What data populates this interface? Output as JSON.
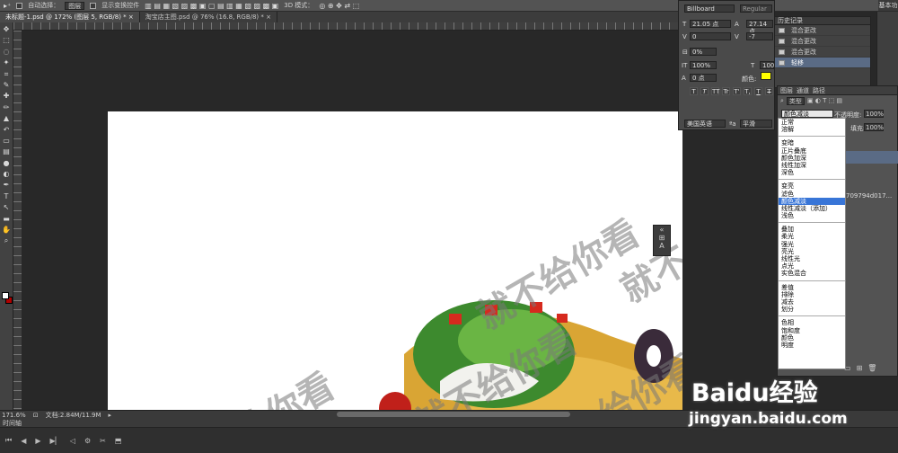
{
  "options_bar": {
    "auto_select_label": "自动选择：",
    "auto_select_value": "图层",
    "show_transform_label": "显示变换控件",
    "mode_3d_label": "3D 模式："
  },
  "tabs": [
    {
      "label": "未标题-1.psd @ 172% (图层 5, RGB/8) *"
    },
    {
      "label": "淘宝店主图.psd @ 76% (16.8, RGB/8) *"
    }
  ],
  "toolbar_icons": [
    "move-icon",
    "marquee-icon",
    "lasso-icon",
    "magic-wand-icon",
    "crop-icon",
    "eyedropper-icon",
    "healing-icon",
    "brush-icon",
    "stamp-icon",
    "history-brush-icon",
    "eraser-icon",
    "gradient-icon",
    "blur-icon",
    "dodge-icon",
    "pen-icon",
    "type-icon",
    "path-select-icon",
    "shape-icon",
    "hand-icon",
    "zoom-icon"
  ],
  "toolbar_glyphs": [
    "✥",
    "⬚",
    "◌",
    "✦",
    "⌗",
    "✎",
    "✚",
    "✏",
    "▲",
    "↶",
    "▭",
    "▤",
    "●",
    "◐",
    "✒",
    "T",
    "↖",
    "▬",
    "✋",
    "⌕"
  ],
  "status": {
    "zoom": "171.6%",
    "doc_size": "文档:2.84M/11.9M"
  },
  "timeline": {
    "title": "时间轴"
  },
  "character": {
    "font_family": "Billboard",
    "font_style": "Regular",
    "font_size": "21.05 点",
    "leading": "27.14 点",
    "kerning": "0",
    "tracking": "-7",
    "vertical_scale_pct": "0%",
    "horizontal_scale": "100%",
    "horizontal_scale2": "100%",
    "baseline": "0 点",
    "color_label": "颜色:",
    "language": "美国英语",
    "aa_label": "ªa",
    "aa_value": "平滑",
    "type_buttons": [
      "T",
      "T",
      "TT",
      "Tr",
      "T'",
      "T,",
      "T",
      "T"
    ]
  },
  "history": {
    "title": "历史记录",
    "items": [
      {
        "label": "混合更改",
        "selected": false
      },
      {
        "label": "混合更改",
        "selected": false
      },
      {
        "label": "混合更改",
        "selected": false
      },
      {
        "label": "轻移",
        "selected": true
      }
    ]
  },
  "workspace": {
    "basic_label": "基本功"
  },
  "layers": {
    "tabs": [
      "图层",
      "通道",
      "路径"
    ],
    "kind_label": "类型",
    "blend_current": "颜色减淡",
    "opacity_label": "不透明度:",
    "opacity_value": "100%",
    "fill_label": "填充:",
    "fill_value": "100%",
    "layer_name_partial": "709794d017..."
  },
  "blend_modes": {
    "groups": [
      [
        {
          "label": "正常"
        },
        {
          "label": "溶解"
        }
      ],
      [
        {
          "label": "变暗"
        },
        {
          "label": "正片叠底"
        },
        {
          "label": "颜色加深"
        },
        {
          "label": "线性加深"
        },
        {
          "label": "深色"
        }
      ],
      [
        {
          "label": "变亮"
        },
        {
          "label": "滤色"
        },
        {
          "label": "颜色减淡",
          "selected": true
        },
        {
          "label": "线性减淡（添加）"
        },
        {
          "label": "浅色"
        }
      ],
      [
        {
          "label": "叠加"
        },
        {
          "label": "柔光"
        },
        {
          "label": "强光"
        },
        {
          "label": "亮光"
        },
        {
          "label": "线性光"
        },
        {
          "label": "点光"
        },
        {
          "label": "实色混合"
        }
      ],
      [
        {
          "label": "差值"
        },
        {
          "label": "排除"
        },
        {
          "label": "减去"
        },
        {
          "label": "划分"
        }
      ],
      [
        {
          "label": "色相"
        },
        {
          "label": "饱和度"
        },
        {
          "label": "颜色"
        },
        {
          "label": "明度"
        }
      ]
    ]
  },
  "canvas": {
    "watermark_text": "就不给你看",
    "watermark_text_partial": "给你看"
  },
  "baidu_watermark": {
    "logo_text": "Baidu经验",
    "url": "jingyan.baidu.com"
  },
  "colors": {
    "selection": "#5a6b85",
    "foreground": "#ffffff",
    "background": "#b00000",
    "text_color_swatch": "#ffff00",
    "blend_highlight": "#3875d7"
  }
}
